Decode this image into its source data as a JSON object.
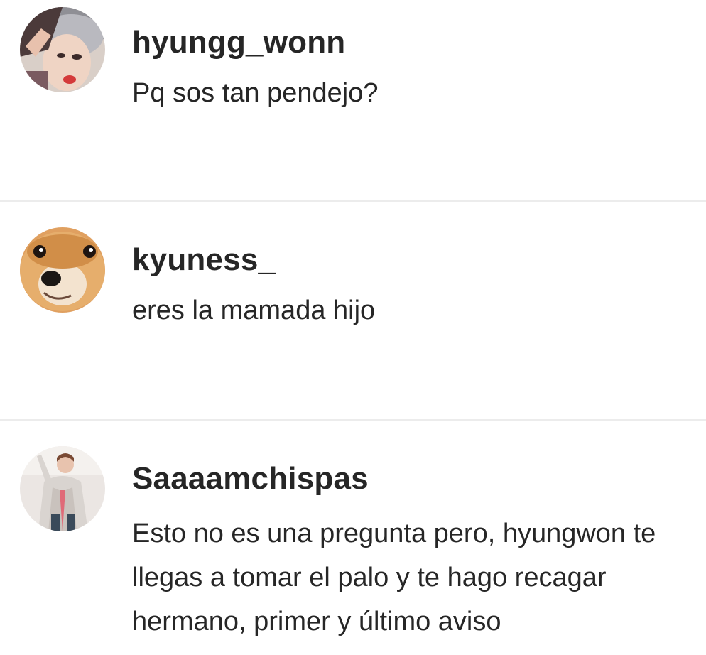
{
  "comments": [
    {
      "username": "hyungg_wonn",
      "text": "Pq sos tan pendejo?",
      "avatar_icon": "person-photo-avatar"
    },
    {
      "username": "kyuness_",
      "text": "eres la mamada hijo",
      "avatar_icon": "shiba-dog-avatar"
    },
    {
      "username": "Saaaamchispas",
      "text": "Esto no es una pregunta pero, hyungwon te llegas a tomar el palo y te hago recagar hermano, primer y último aviso",
      "avatar_icon": "person-in-coat-avatar"
    }
  ],
  "colors": {
    "text": "#262626",
    "divider": "#ececec",
    "background": "#ffffff"
  }
}
